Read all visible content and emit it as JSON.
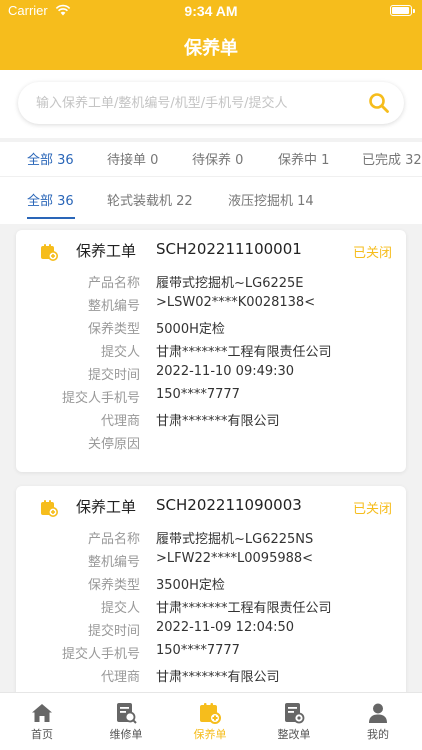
{
  "status_bar": {
    "carrier": "Carrier",
    "time": "9:34 AM"
  },
  "header": {
    "title": "保养单"
  },
  "search": {
    "placeholder": "输入保养工单/整机编号/机型/手机号/提交人"
  },
  "status_tabs": [
    {
      "label": "全部 36"
    },
    {
      "label": "待接单 0"
    },
    {
      "label": "待保养 0"
    },
    {
      "label": "保养中 1"
    },
    {
      "label": "已完成 32"
    }
  ],
  "type_tabs": [
    {
      "label": "全部 36"
    },
    {
      "label": "轮式装载机 22"
    },
    {
      "label": "液压挖掘机 14"
    }
  ],
  "cards": [
    {
      "head_label": "保养工单",
      "order_no": "SCH202211100001",
      "status": "已关闭",
      "rows": [
        {
          "label": "产品名称",
          "value": "履带式挖掘机~LG6225E"
        },
        {
          "label": "整机编号",
          "value": ">LSW02****K0028138<"
        },
        {
          "label": "保养类型",
          "value": "5000H定检"
        },
        {
          "label": "提交人",
          "value": "甘肃*******工程有限责任公司"
        },
        {
          "label": "提交时间",
          "value": "2022-11-10 09:49:30"
        },
        {
          "label": "提交人手机号",
          "value": "150****7777"
        },
        {
          "label": "代理商",
          "value": "甘肃*******有限公司"
        },
        {
          "label": "关停原因",
          "value": ""
        }
      ]
    },
    {
      "head_label": "保养工单",
      "order_no": "SCH202211090003",
      "status": "已关闭",
      "rows": [
        {
          "label": "产品名称",
          "value": "履带式挖掘机~LG6225NS"
        },
        {
          "label": "整机编号",
          "value": ">LFW22****L0095988<"
        },
        {
          "label": "保养类型",
          "value": "3500H定检"
        },
        {
          "label": "提交人",
          "value": "甘肃*******工程有限责任公司"
        },
        {
          "label": "提交时间",
          "value": "2022-11-09 12:04:50"
        },
        {
          "label": "提交人手机号",
          "value": "150****7777"
        },
        {
          "label": "代理商",
          "value": "甘肃*******有限公司"
        }
      ]
    }
  ],
  "tabbar": [
    {
      "label": "首页",
      "icon": "home-icon"
    },
    {
      "label": "维修单",
      "icon": "repair-order-icon"
    },
    {
      "label": "保养单",
      "icon": "maintenance-order-icon"
    },
    {
      "label": "整改单",
      "icon": "rectification-order-icon"
    },
    {
      "label": "我的",
      "icon": "profile-icon"
    }
  ],
  "colors": {
    "brand": "#f6bd1c",
    "tab_active": "#2a66b8",
    "status_closed": "#f6bd1c"
  }
}
